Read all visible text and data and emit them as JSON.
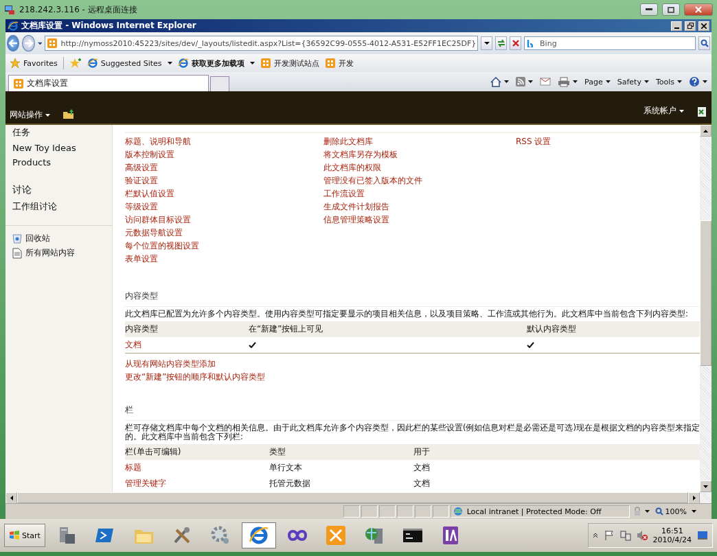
{
  "rdp_window": {
    "title": "218.242.3.116 - 远程桌面连接"
  },
  "browser": {
    "title": "文档库设置 - Windows Internet Explorer",
    "address": "http://nymoss2010:45223/sites/dev/_layouts/listedit.aspx?List={36592C99-0555-4012-A531-E52FF1EC25DF}",
    "search": {
      "placeholder": "Bing"
    },
    "favorites_bar": [
      {
        "label": "Favorites",
        "kind": "star",
        "bold": false,
        "dropdown": false
      },
      {
        "label": "Suggested Sites",
        "kind": "ie",
        "bold": false,
        "dropdown": true
      },
      {
        "label": "获取更多加载项",
        "kind": "ie",
        "bold": true,
        "dropdown": true
      },
      {
        "label": "开发测试站点",
        "kind": "site",
        "bold": false,
        "dropdown": false
      },
      {
        "label": "开发",
        "kind": "site",
        "bold": false,
        "dropdown": false
      }
    ],
    "tab": {
      "label": "文档库设置"
    },
    "command_menus": [
      "Page",
      "Safety",
      "Tools"
    ]
  },
  "site_header": {
    "actions_menu": "网站操作",
    "user": "系统帐户"
  },
  "sidebar": {
    "items": [
      {
        "label": "任务",
        "kind": "link"
      },
      {
        "label": "New Toy Ideas",
        "kind": "link"
      },
      {
        "label": "Products",
        "kind": "link"
      },
      {
        "label": "讨论",
        "kind": "heading"
      },
      {
        "label": "工作组讨论",
        "kind": "link"
      }
    ],
    "footer_links": [
      {
        "label": "回收站",
        "kind": "recycle"
      },
      {
        "label": "所有网站内容",
        "kind": "document"
      }
    ]
  },
  "settings_links": [
    [
      "标题、说明和导航",
      "版本控制设置",
      "高级设置",
      "验证设置",
      "栏默认值设置",
      "等级设置",
      "访问群体目标设置",
      "元数据导航设置",
      "每个位置的视图设置",
      "表单设置"
    ],
    [
      "删除此文档库",
      "将文档库另存为模板",
      "此文档库的权限",
      "管理没有已签入版本的文件",
      "工作流设置",
      "生成文件计划报告",
      "信息管理策略设置"
    ],
    [
      "RSS 设置"
    ]
  ],
  "content_types": {
    "heading": "内容类型",
    "description": "此文档库已配置为允许多个内容类型。使用内容类型可指定要显示的项目相关信息，以及项目策略、工作流或其他行为。此文档库中当前包含下列内容类型:",
    "columns": [
      "内容类型",
      "在“新建”按钮上可见",
      "默认内容类型"
    ],
    "rows": [
      {
        "name": "文档",
        "visible_on_new": true,
        "default": true
      }
    ],
    "links": [
      "从现有网站内容类型添加",
      "更改“新建”按钮的顺序和默认内容类型"
    ]
  },
  "columns_section": {
    "heading": "栏",
    "description": "栏可存储文档库中每个文档的相关信息。由于此文档库允许多个内容类型，因此栏的某些设置(例如信息对栏是必需还是可选)现在是根据文档的内容类型来指定的。此文档库中当前包含下列栏:",
    "columns": [
      "栏(单击可编辑)",
      "类型",
      "用于"
    ],
    "rows": [
      {
        "name": "标题",
        "type": "单行文本",
        "used_in": "文档"
      },
      {
        "name": "管理关键字",
        "type": "托管元数据",
        "used_in": "文档"
      }
    ]
  },
  "status_bar": {
    "zone": "Local intranet | Protected Mode: Off",
    "zoom": "100%"
  },
  "taskbar": {
    "start": "Start",
    "apps": [
      {
        "kind": "server",
        "selected": false
      },
      {
        "kind": "shell",
        "selected": false
      },
      {
        "kind": "folder",
        "selected": false
      },
      {
        "kind": "tools",
        "selected": false
      },
      {
        "kind": "gear",
        "selected": false
      },
      {
        "kind": "ie",
        "selected": true
      },
      {
        "kind": "infinity",
        "selected": false
      },
      {
        "kind": "toolbox",
        "selected": false
      },
      {
        "kind": "network",
        "selected": false
      },
      {
        "kind": "console",
        "selected": false
      },
      {
        "kind": "note",
        "selected": false
      }
    ],
    "time": "16:51",
    "date": "2010/4/24"
  }
}
